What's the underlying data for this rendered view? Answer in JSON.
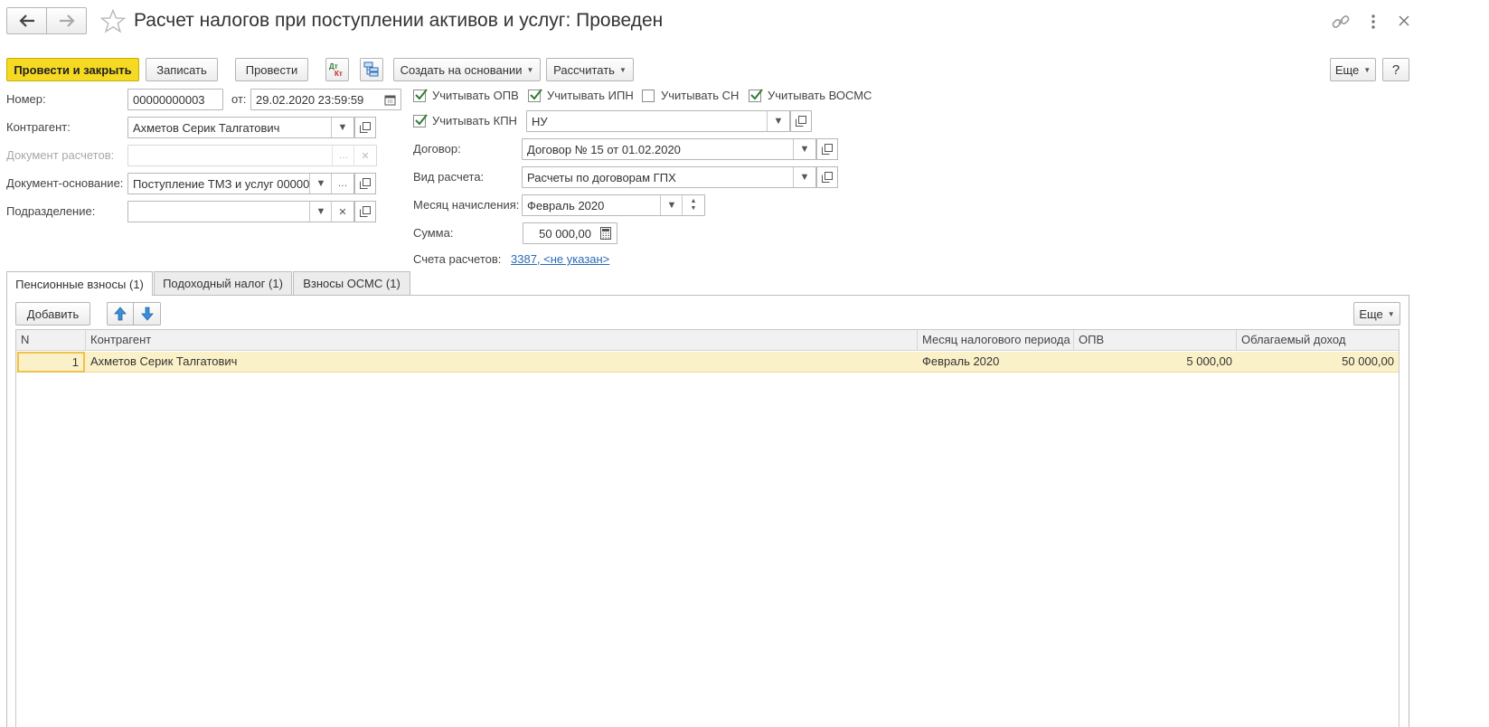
{
  "title": "Расчет налогов при поступлении активов и услуг: Проведен",
  "toolbar": {
    "post_close": "Провести и закрыть",
    "write": "Записать",
    "post": "Провести",
    "create_based": "Создать на основании",
    "calculate": "Рассчитать",
    "more": "Еще",
    "help": "?"
  },
  "form": {
    "number_label": "Номер:",
    "number_value": "00000000003",
    "date_label": "от:",
    "date_value": "29.02.2020 23:59:59",
    "counterparty_label": "Контрагент:",
    "counterparty_value": "Ахметов Серик Талгатович",
    "settlement_doc_label": "Документ расчетов:",
    "basis_doc_label": "Документ-основание:",
    "basis_doc_value": "Поступление ТМЗ и услуг 00000",
    "division_label": "Подразделение:",
    "division_value": "",
    "chk_opv": "Учитывать ОПВ",
    "chk_ipn": "Учитывать ИПН",
    "chk_sn": "Учитывать СН",
    "chk_vosms": "Учитывать ВОСМС",
    "chk_kpn": "Учитывать КПН",
    "kpn_value": "НУ",
    "contract_label": "Договор:",
    "contract_value": "Договор № 15 от 01.02.2020",
    "calc_type_label": "Вид расчета:",
    "calc_type_value": "Расчеты по договорам ГПХ",
    "month_label": "Месяц начисления:",
    "month_value": "Февраль 2020",
    "sum_label": "Сумма:",
    "sum_value": "50 000,00",
    "accounts_label": "Счета расчетов:",
    "accounts_value": "3387, <не указан>"
  },
  "checks": {
    "opv": true,
    "ipn": true,
    "sn": false,
    "vosms": true,
    "kpn": true
  },
  "tabs": [
    "Пенсионные взносы (1)",
    "Подоходный налог (1)",
    "Взносы ОСМС (1)"
  ],
  "table_toolbar": {
    "add": "Добавить",
    "more": "Еще"
  },
  "table": {
    "columns": [
      "N",
      "Контрагент",
      "Месяц налогового периода",
      "ОПВ",
      "Облагаемый доход"
    ],
    "rows": [
      {
        "n": "1",
        "counterparty": "Ахметов Серик Талгатович",
        "month": "Февраль 2020",
        "opv": "5 000,00",
        "income": "50 000,00"
      }
    ]
  },
  "colors": {
    "primary_button": "#f5d923",
    "selected_row": "#fbf1c8",
    "link": "#2a6ab5",
    "check": "#2e7d32"
  }
}
